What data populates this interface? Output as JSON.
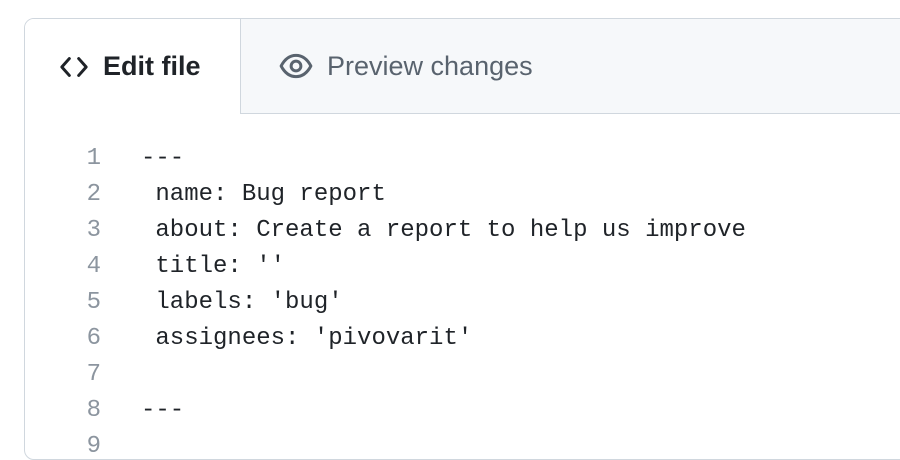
{
  "tabs": {
    "edit": {
      "label": "Edit file",
      "icon": "code-icon"
    },
    "preview": {
      "label": "Preview changes",
      "icon": "eye-icon"
    }
  },
  "editor": {
    "lines": [
      {
        "number": "1",
        "text": "---"
      },
      {
        "number": "2",
        "text": " name: Bug report"
      },
      {
        "number": "3",
        "text": " about: Create a report to help us improve"
      },
      {
        "number": "4",
        "text": " title: ''"
      },
      {
        "number": "5",
        "text": " labels: 'bug'"
      },
      {
        "number": "6",
        "text": " assignees: 'pivovarit'"
      },
      {
        "number": "7",
        "text": ""
      },
      {
        "number": "8",
        "text": "---"
      },
      {
        "number": "9",
        "text": ""
      }
    ]
  },
  "colors": {
    "border": "#d0d7de",
    "tabbar_bg": "#f6f8fa",
    "text": "#1f2328",
    "muted": "#59636e",
    "line_number": "#8c959f"
  }
}
